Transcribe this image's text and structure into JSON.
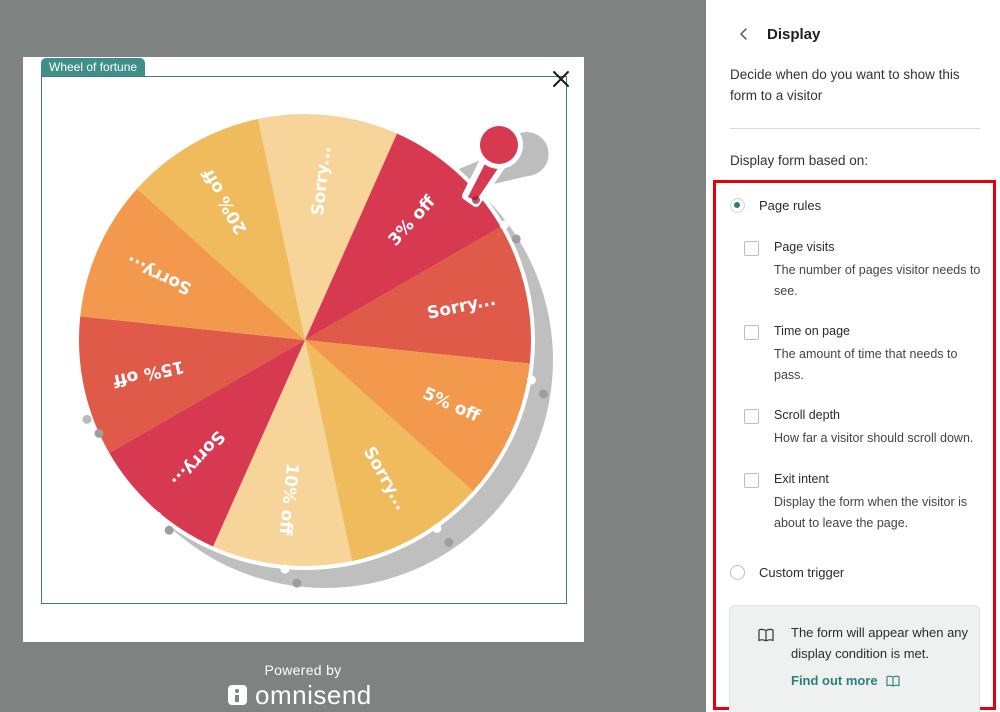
{
  "preview": {
    "form_tag": "Wheel of fortune",
    "wheel_segments": [
      {
        "label": "3% off",
        "color": "#d73950"
      },
      {
        "label": "Sorry...",
        "color": "#df5a48"
      },
      {
        "label": "5% off",
        "color": "#f3994d"
      },
      {
        "label": "Sorry...",
        "color": "#efbb5c"
      },
      {
        "label": "10% off",
        "color": "#f7d49a"
      },
      {
        "label": "Sorry...",
        "color": "#d73950"
      },
      {
        "label": "15% off",
        "color": "#df5a48"
      },
      {
        "label": "Sorry...",
        "color": "#f3994d"
      },
      {
        "label": "20% off",
        "color": "#efbb5c"
      },
      {
        "label": "Sorry...",
        "color": "#f7d49a"
      }
    ],
    "pointer_color": "#d73950",
    "powered_by": "Powered by",
    "brand": "omnisend"
  },
  "panel": {
    "title": "Display",
    "description": "Decide when do you want to show this form to a visitor",
    "based_on_label": "Display form based on:",
    "options": [
      {
        "label": "Page rules",
        "selected": true
      },
      {
        "label": "Custom trigger",
        "selected": false
      }
    ],
    "page_rules": [
      {
        "title": "Page visits",
        "description": "The number of pages visitor needs to see.",
        "checked": false
      },
      {
        "title": "Time on page",
        "description": "The amount of time that needs to pass.",
        "checked": false
      },
      {
        "title": "Scroll depth",
        "description": "How far a visitor should scroll down.",
        "checked": false
      },
      {
        "title": "Exit intent",
        "description": "Display the form when the visitor is about to leave the page.",
        "checked": false
      }
    ],
    "info_text": "The form will appear when any display condition is met.",
    "info_link": "Find out more",
    "accent_color": "#2e7f78",
    "highlight_color": "#e3000f"
  }
}
